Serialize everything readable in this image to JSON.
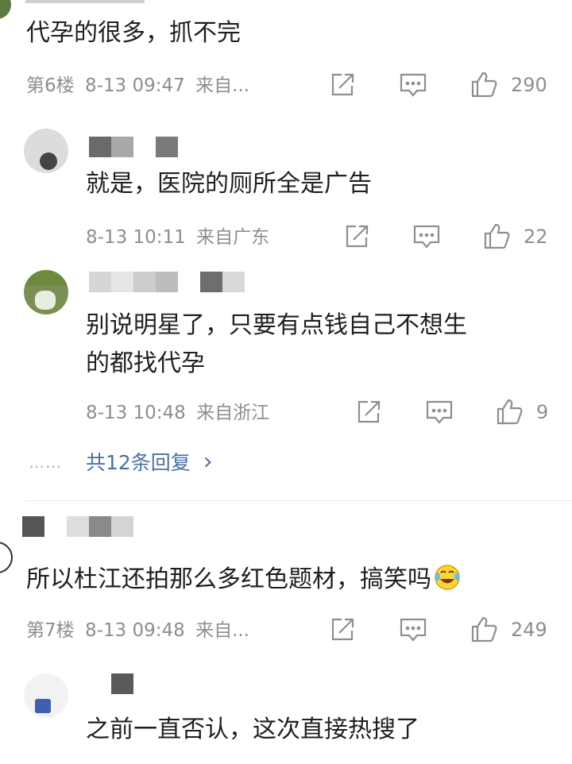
{
  "comments": [
    {
      "id": "c6",
      "text": "代孕的很多，抓不完",
      "floor": "第6楼",
      "time": "8-13 09:47",
      "source": "来自...",
      "likes": "290"
    },
    {
      "id": "r1",
      "text": "就是，医院的厕所全是广告",
      "time": "8-13 10:11",
      "source": "来自广东",
      "likes": "22"
    },
    {
      "id": "r2",
      "text_line1": "别说明星了，只要有点钱自己不想生",
      "text_line2": "的都找代孕",
      "time": "8-13 10:48",
      "source": "来自浙江",
      "likes": "9"
    },
    {
      "id": "c7",
      "text": "所以杜江还拍那么多红色题材，搞笑吗",
      "floor": "第7楼",
      "time": "8-13 09:48",
      "source": "来自...",
      "likes": "249"
    },
    {
      "id": "r3",
      "text": "之前一直否认，这次直接热搜了"
    }
  ],
  "replies_summary": {
    "dots": "……",
    "label": "共12条回复",
    "chevron": "›"
  },
  "icons": {
    "share": "share-icon",
    "comment": "comment-icon",
    "like": "thumbs-up-icon",
    "laugh_emoji": "laughing-crying-emoji-icon"
  },
  "colors": {
    "meta": "#8e8e8e",
    "text": "#1f1f1f",
    "link": "#4a6fa5",
    "divider": "#e8e8e8"
  }
}
